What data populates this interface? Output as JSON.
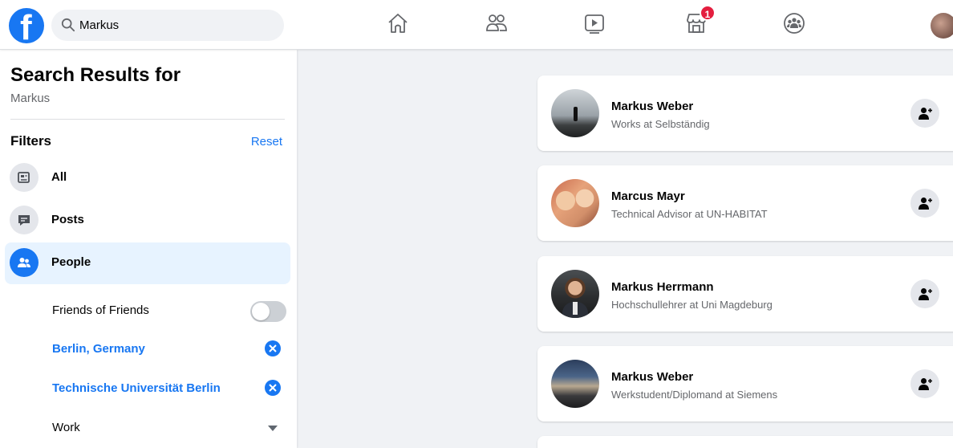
{
  "topbar": {
    "search_value": "Markus",
    "marketplace_badge": "1"
  },
  "sidebar": {
    "title": "Search Results for",
    "query": "Markus",
    "filters_label": "Filters",
    "reset_label": "Reset",
    "items": [
      {
        "label": "All",
        "icon": "posts-feed-icon"
      },
      {
        "label": "Posts",
        "icon": "speech-bubble-icon"
      },
      {
        "label": "People",
        "icon": "people-icon"
      }
    ],
    "sub_filters": [
      {
        "label": "Friends of Friends",
        "control": "toggle",
        "on": false
      },
      {
        "label": "Berlin, Germany",
        "control": "remove"
      },
      {
        "label": "Technische Universität Berlin",
        "control": "remove"
      },
      {
        "label": "Work",
        "control": "dropdown"
      }
    ]
  },
  "results": [
    {
      "name": "Markus Weber",
      "desc": "Works at Selbständig"
    },
    {
      "name": "Marcus Mayr",
      "desc": "Technical Advisor at UN-HABITAT"
    },
    {
      "name": "Markus Herrmann",
      "desc": "Hochschullehrer at Uni Magdeburg"
    },
    {
      "name": "Markus Weber",
      "desc": "Werkstudent/Diplomand at Siemens"
    }
  ],
  "colors": {
    "accent": "#1877f2",
    "badge": "#e41e3f",
    "background": "#f0f2f5"
  }
}
